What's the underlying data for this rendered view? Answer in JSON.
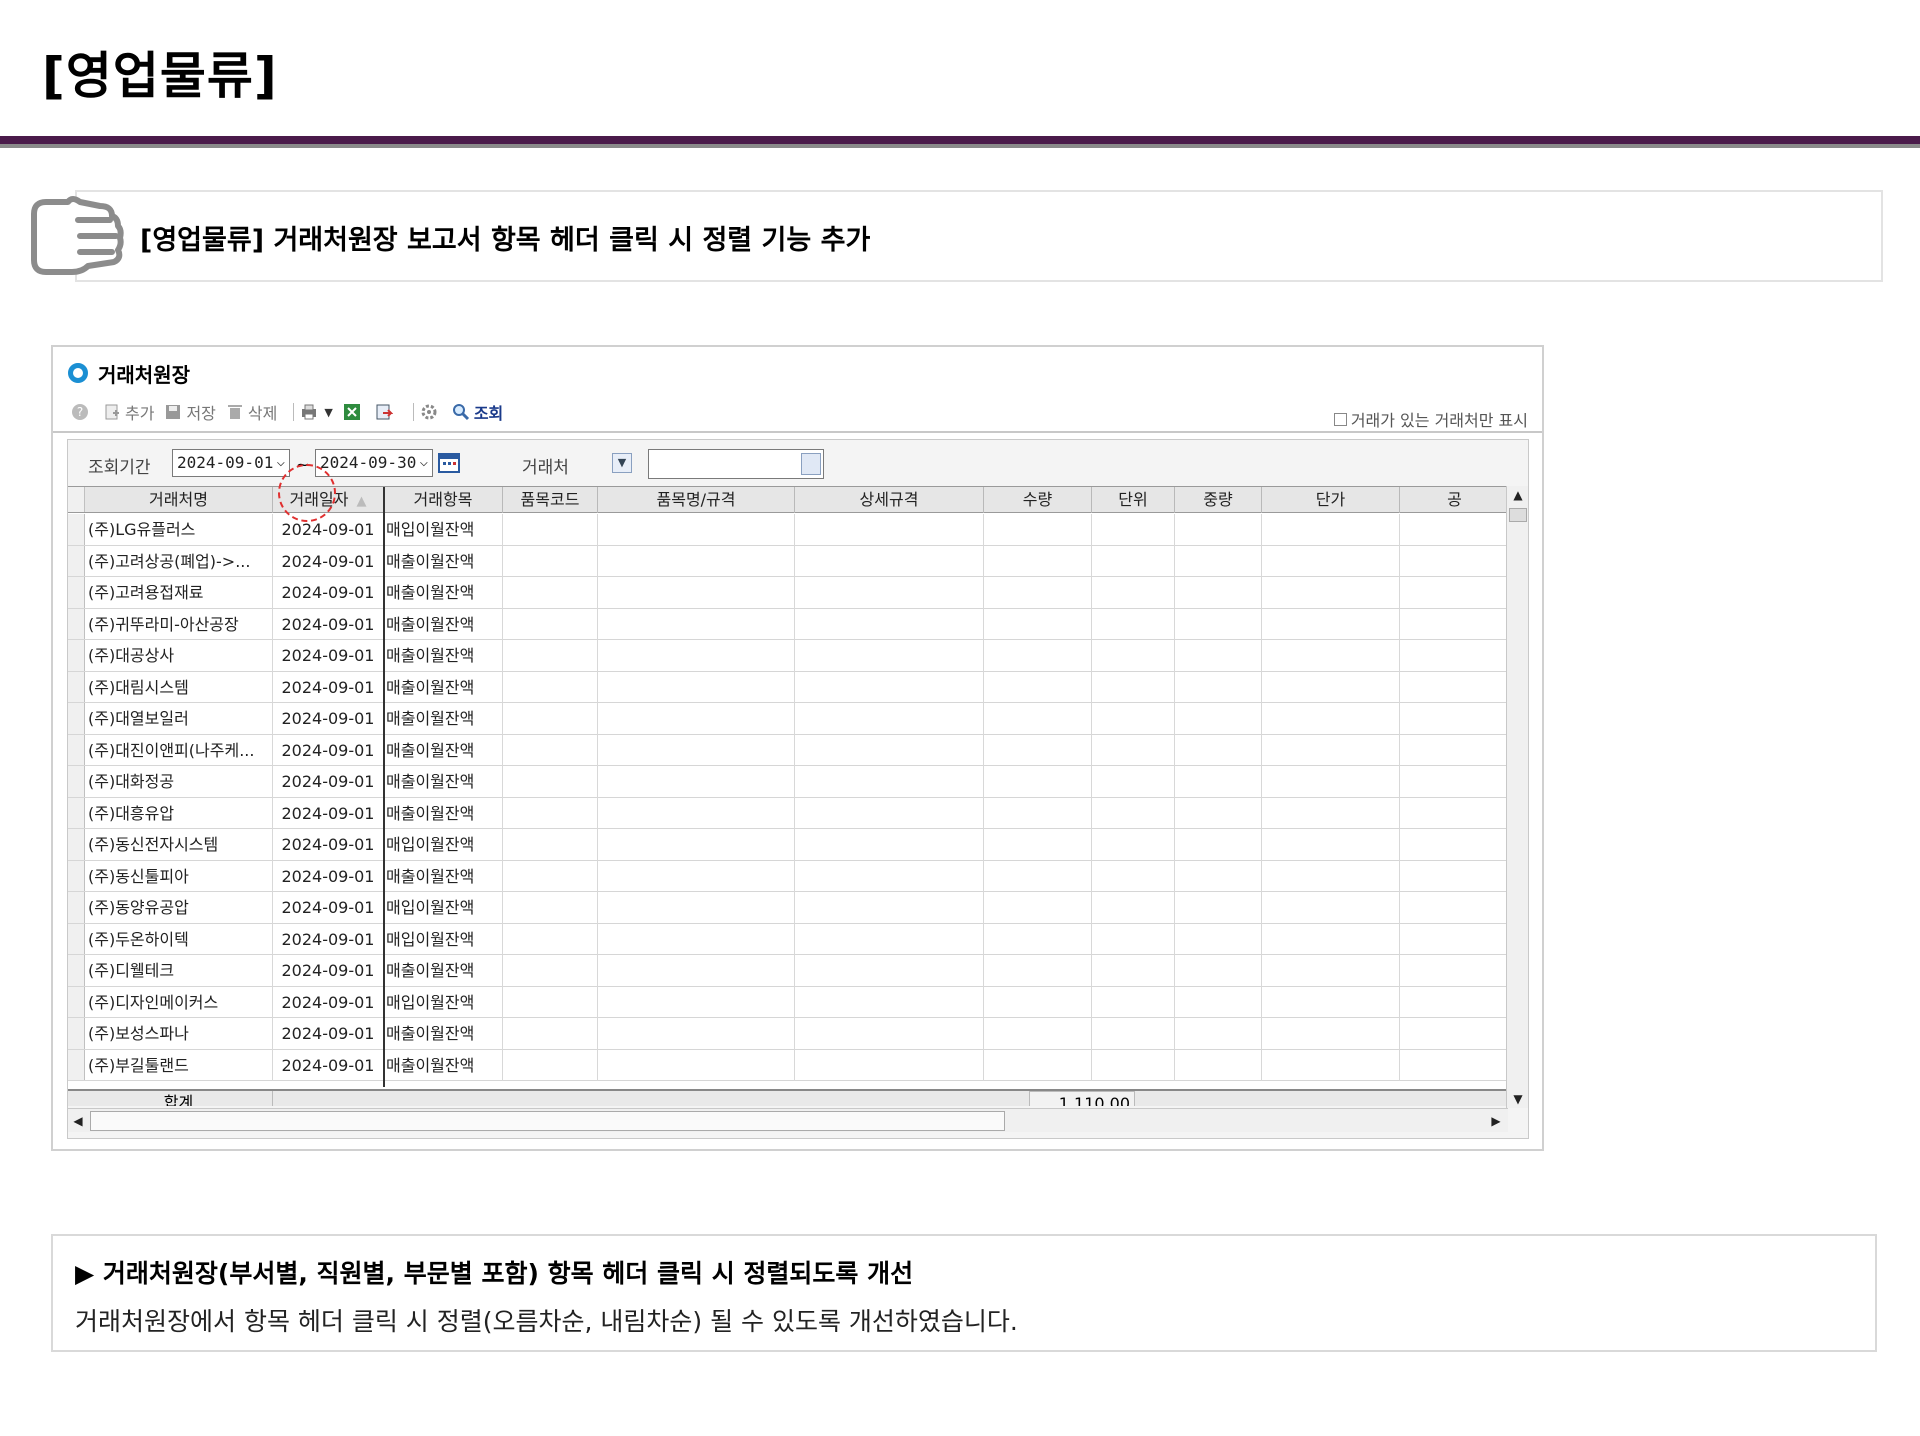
{
  "page": {
    "title": "[영업물류]",
    "summary": "[영업물류] 거래처원장 보고서 항목 헤더 클릭 시 정렬 기능 추가"
  },
  "window": {
    "title": "거래처원장",
    "toolbar": {
      "add": "추가",
      "save": "저장",
      "delete": "삭제",
      "search": "조회"
    },
    "show_only_label": "거래가 있는 거래처만 표시",
    "filter": {
      "period_label": "조회기간",
      "date_from": "2024-09-01",
      "tilde": "~",
      "date_to": "2024-09-30",
      "partner_label": "거래처",
      "partner_value": ""
    },
    "grid": {
      "columns": [
        "거래처명",
        "거래일자",
        "거래항목",
        "품목코드",
        "품목명/규격",
        "상세규격",
        "수량",
        "단위",
        "중량",
        "단가",
        "공"
      ],
      "sort_indicator": "▲",
      "rows": [
        {
          "name": "(주)LG유플러스",
          "date": "2024-09-01",
          "item": "매입이월잔액"
        },
        {
          "name": "(주)고려상공(폐업)->...",
          "date": "2024-09-01",
          "item": "매출이월잔액"
        },
        {
          "name": "(주)고려용접재료",
          "date": "2024-09-01",
          "item": "매출이월잔액"
        },
        {
          "name": "(주)귀뚜라미-아산공장",
          "date": "2024-09-01",
          "item": "매출이월잔액"
        },
        {
          "name": "(주)대공상사",
          "date": "2024-09-01",
          "item": "매출이월잔액"
        },
        {
          "name": "(주)대림시스템",
          "date": "2024-09-01",
          "item": "매출이월잔액"
        },
        {
          "name": "(주)대열보일러",
          "date": "2024-09-01",
          "item": "매출이월잔액"
        },
        {
          "name": "(주)대진이앤피(나주케...",
          "date": "2024-09-01",
          "item": "매출이월잔액"
        },
        {
          "name": "(주)대화정공",
          "date": "2024-09-01",
          "item": "매출이월잔액"
        },
        {
          "name": "(주)대흥유압",
          "date": "2024-09-01",
          "item": "매출이월잔액"
        },
        {
          "name": "(주)동신전자시스템",
          "date": "2024-09-01",
          "item": "매입이월잔액"
        },
        {
          "name": "(주)동신툴피아",
          "date": "2024-09-01",
          "item": "매출이월잔액"
        },
        {
          "name": "(주)동양유공압",
          "date": "2024-09-01",
          "item": "매입이월잔액"
        },
        {
          "name": "(주)두온하이텍",
          "date": "2024-09-01",
          "item": "매입이월잔액"
        },
        {
          "name": "(주)디웰테크",
          "date": "2024-09-01",
          "item": "매출이월잔액"
        },
        {
          "name": "(주)디자인메이커스",
          "date": "2024-09-01",
          "item": "매입이월잔액"
        },
        {
          "name": "(주)보성스파나",
          "date": "2024-09-01",
          "item": "매출이월잔액"
        },
        {
          "name": "(주)부길툴랜드",
          "date": "2024-09-01",
          "item": "매출이월잔액"
        }
      ],
      "footer": {
        "label": "합계",
        "quantity_total": "1,110.00"
      }
    }
  },
  "description": {
    "heading": "▶ 거래처원장(부서별, 직원별, 부문별 포함) 항목 헤더 클릭 시 정렬되도록 개선",
    "body": "거래처원장에서 항목 헤더 클릭 시 정렬(오름차순, 내림차순) 될 수 있도록 개선하였습니다."
  },
  "colors": {
    "title_bar": "#4a1a4a",
    "accent_blue": "#1b8fd3",
    "highlight_red": "#e03030"
  }
}
